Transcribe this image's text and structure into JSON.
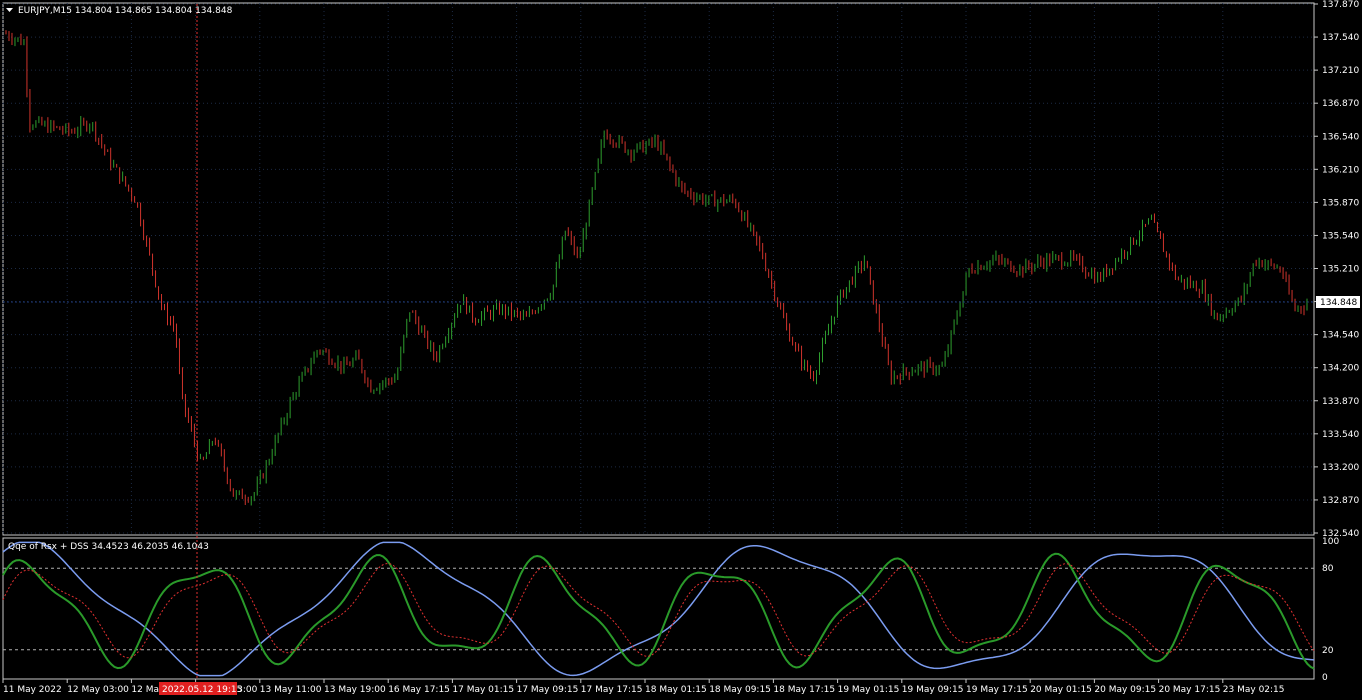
{
  "window": {
    "symbol_header": "EURJPY,M15  134.804 134.865 134.804 134.848",
    "indicator_header": "Qqe of Rsx + DSS 34.4523 46.2035 46.1043",
    "current_price": "134.848",
    "crosshair_time_label": "2022.05.12 19:15"
  },
  "price_axis": [
    "137.870",
    "137.540",
    "137.210",
    "136.870",
    "136.540",
    "136.210",
    "135.870",
    "135.540",
    "135.210",
    "134.870",
    "134.540",
    "134.200",
    "133.870",
    "133.540",
    "133.200",
    "132.870",
    "132.540"
  ],
  "indicator_axis": [
    "100",
    "80",
    "20",
    "0"
  ],
  "time_axis": [
    "11 May 2022",
    "12 May 03:00",
    "12 May 11:00",
    "13 May 03:00",
    "13 May 11:00",
    "13 May 19:00",
    "16 May 17:15",
    "17 May 01:15",
    "17 May 09:15",
    "17 May 17:15",
    "18 May 01:15",
    "18 May 09:15",
    "18 May 17:15",
    "19 May 01:15",
    "19 May 09:15",
    "19 May 17:15",
    "20 May 01:15",
    "20 May 09:15",
    "20 May 17:15",
    "23 May 02:15"
  ],
  "colors": {
    "background": "#000000",
    "bull_candle": "#2e9e2e",
    "bear_candle": "#d0342c",
    "grid": "#1c2a44",
    "axis_line": "#c8c8c8",
    "bid_line": "#1e3a78",
    "crosshair": "#e03030",
    "qqe_fast": "#2a9a2a",
    "qqe_slow": "#e03030",
    "dss_line": "#7b9cf0",
    "level_line": "#b0b0b0"
  },
  "chart_data": {
    "type": "candlestick",
    "symbol": "EURJPY",
    "timeframe": "M15",
    "y_range": [
      132.54,
      137.87
    ],
    "price_path_x": [
      0,
      0.015,
      0.017,
      0.05,
      0.065,
      0.08,
      0.1,
      0.12,
      0.13,
      0.135,
      0.15,
      0.16,
      0.175,
      0.19,
      0.2,
      0.22,
      0.24,
      0.26,
      0.27,
      0.28,
      0.3,
      0.31,
      0.33,
      0.35,
      0.36,
      0.38,
      0.4,
      0.42,
      0.43,
      0.44,
      0.46,
      0.48,
      0.5,
      0.52,
      0.54,
      0.56,
      0.58,
      0.6,
      0.61,
      0.62,
      0.64,
      0.66,
      0.68,
      0.7,
      0.72,
      0.74,
      0.76,
      0.78,
      0.8,
      0.82,
      0.84,
      0.86,
      0.88,
      0.9,
      0.92,
      0.93,
      0.95,
      0.96,
      0.98,
      0.99,
      1.0
    ],
    "price_path_y": [
      137.6,
      137.5,
      136.7,
      136.6,
      136.7,
      136.3,
      135.9,
      134.8,
      134.6,
      133.9,
      133.2,
      133.5,
      132.9,
      132.9,
      133.2,
      133.9,
      134.4,
      134.2,
      134.3,
      134.0,
      134.1,
      134.8,
      134.3,
      134.9,
      134.7,
      134.8,
      134.7,
      135.0,
      135.6,
      135.3,
      136.6,
      136.4,
      136.5,
      136.0,
      135.9,
      135.9,
      135.4,
      134.6,
      134.3,
      134.1,
      134.9,
      135.3,
      134.1,
      134.2,
      134.2,
      135.2,
      135.3,
      135.2,
      135.3,
      135.3,
      135.1,
      135.4,
      135.7,
      135.1,
      135.0,
      134.7,
      134.9,
      135.3,
      135.2,
      134.8,
      134.85
    ],
    "indicator": {
      "name": "Qqe of Rsx + DSS",
      "values": [
        34.4523,
        46.2035,
        46.1043
      ],
      "levels": [
        100,
        80,
        20,
        0
      ],
      "y_range": [
        0,
        100
      ]
    }
  }
}
